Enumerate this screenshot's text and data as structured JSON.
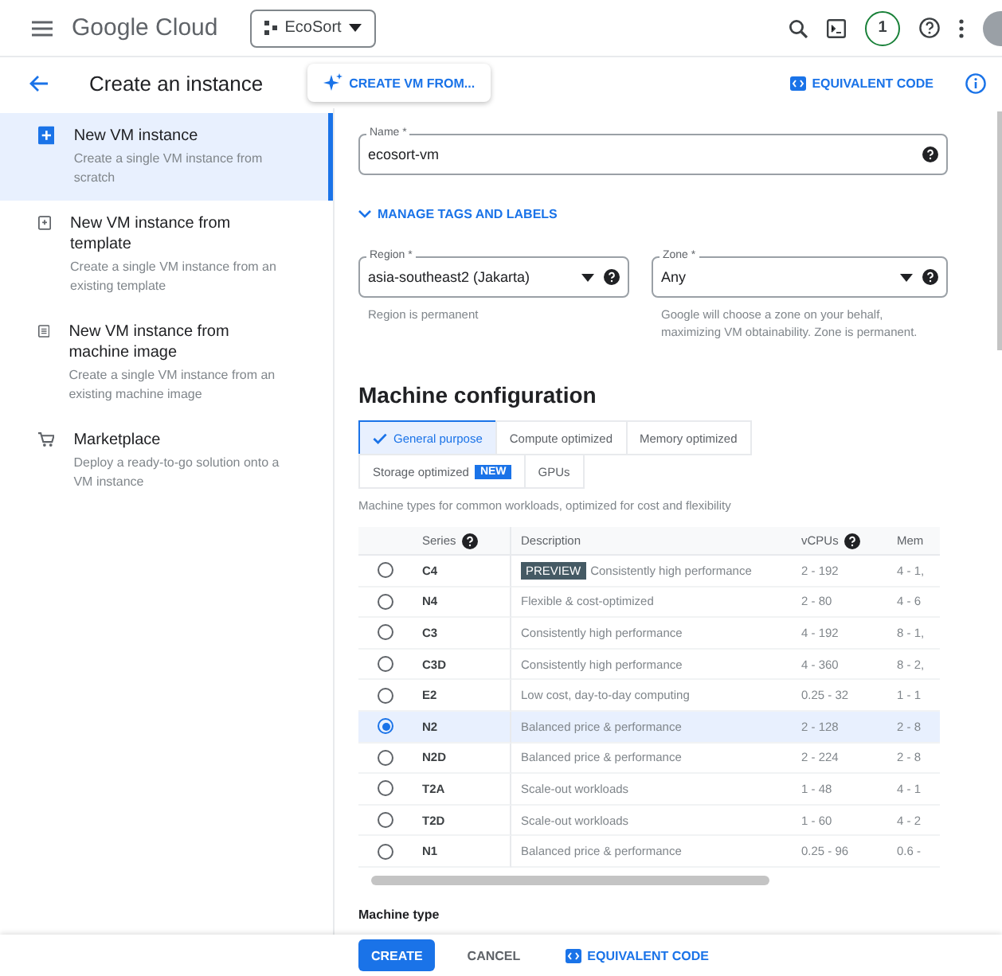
{
  "topbar": {
    "product": "Google Cloud",
    "project": "EcoSort",
    "notifications": "1"
  },
  "header": {
    "title": "Create an instance",
    "create_from": "CREATE VM FROM...",
    "equivalent_code": "EQUIVALENT CODE"
  },
  "sidebar": {
    "items": [
      {
        "title": "New VM instance",
        "description": "Create a single VM instance from scratch",
        "selected": true
      },
      {
        "title": "New VM instance from template",
        "description": "Create a single VM instance from an existing template",
        "selected": false
      },
      {
        "title": "New VM instance from machine image",
        "description": "Create a single VM instance from an existing machine image",
        "selected": false
      },
      {
        "title": "Marketplace",
        "description": "Deploy a ready-to-go solution onto a VM instance",
        "selected": false
      }
    ]
  },
  "form": {
    "name": {
      "label": "Name *",
      "value": "ecosort-vm"
    },
    "manage_tags": "MANAGE TAGS AND LABELS",
    "region": {
      "label": "Region *",
      "value": "asia-southeast2 (Jakarta)",
      "hint": "Region is permanent"
    },
    "zone": {
      "label": "Zone *",
      "value": "Any",
      "hint": "Google will choose a zone on your behalf, maximizing VM obtainability. Zone is permanent."
    }
  },
  "machine_configuration": {
    "heading": "Machine configuration",
    "tabs": [
      {
        "label": "General purpose",
        "selected": true
      },
      {
        "label": "Compute optimized",
        "selected": false
      },
      {
        "label": "Memory optimized",
        "selected": false
      },
      {
        "label": "Storage optimized",
        "badge": "NEW",
        "selected": false
      },
      {
        "label": "GPUs",
        "selected": false
      }
    ],
    "description": "Machine types for common workloads, optimized for cost and flexibility",
    "table": {
      "columns": [
        "Series",
        "Description",
        "vCPUs",
        "Mem"
      ],
      "rows": [
        {
          "series": "C4",
          "tag": "PREVIEW",
          "description": "Consistently high performance",
          "vcpus": "2 - 192",
          "memory": "4 - 1,",
          "selected": false
        },
        {
          "series": "N4",
          "description": "Flexible & cost-optimized",
          "vcpus": "2 - 80",
          "memory": "4 - 6",
          "selected": false
        },
        {
          "series": "C3",
          "description": "Consistently high performance",
          "vcpus": "4 - 192",
          "memory": "8 - 1,",
          "selected": false
        },
        {
          "series": "C3D",
          "description": "Consistently high performance",
          "vcpus": "4 - 360",
          "memory": "8 - 2,",
          "selected": false
        },
        {
          "series": "E2",
          "description": "Low cost, day-to-day computing",
          "vcpus": "0.25 - 32",
          "memory": "1 - 1",
          "selected": false
        },
        {
          "series": "N2",
          "description": "Balanced price & performance",
          "vcpus": "2 - 128",
          "memory": "2 - 8",
          "selected": true
        },
        {
          "series": "N2D",
          "description": "Balanced price & performance",
          "vcpus": "2 - 224",
          "memory": "2 - 8",
          "selected": false
        },
        {
          "series": "T2A",
          "description": "Scale-out workloads",
          "vcpus": "1 - 48",
          "memory": "4 - 1",
          "selected": false
        },
        {
          "series": "T2D",
          "description": "Scale-out workloads",
          "vcpus": "1 - 60",
          "memory": "4 - 2",
          "selected": false
        },
        {
          "series": "N1",
          "description": "Balanced price & performance",
          "vcpus": "0.25 - 96",
          "memory": "0.6 -",
          "selected": false
        }
      ]
    },
    "machine_type": "Machine type"
  },
  "footer": {
    "buttons": [
      {
        "label": "CREATE",
        "kind": "primary"
      },
      {
        "label": "CANCEL",
        "kind": "text"
      },
      {
        "label": "EQUIVALENT CODE",
        "kind": "code"
      }
    ]
  }
}
